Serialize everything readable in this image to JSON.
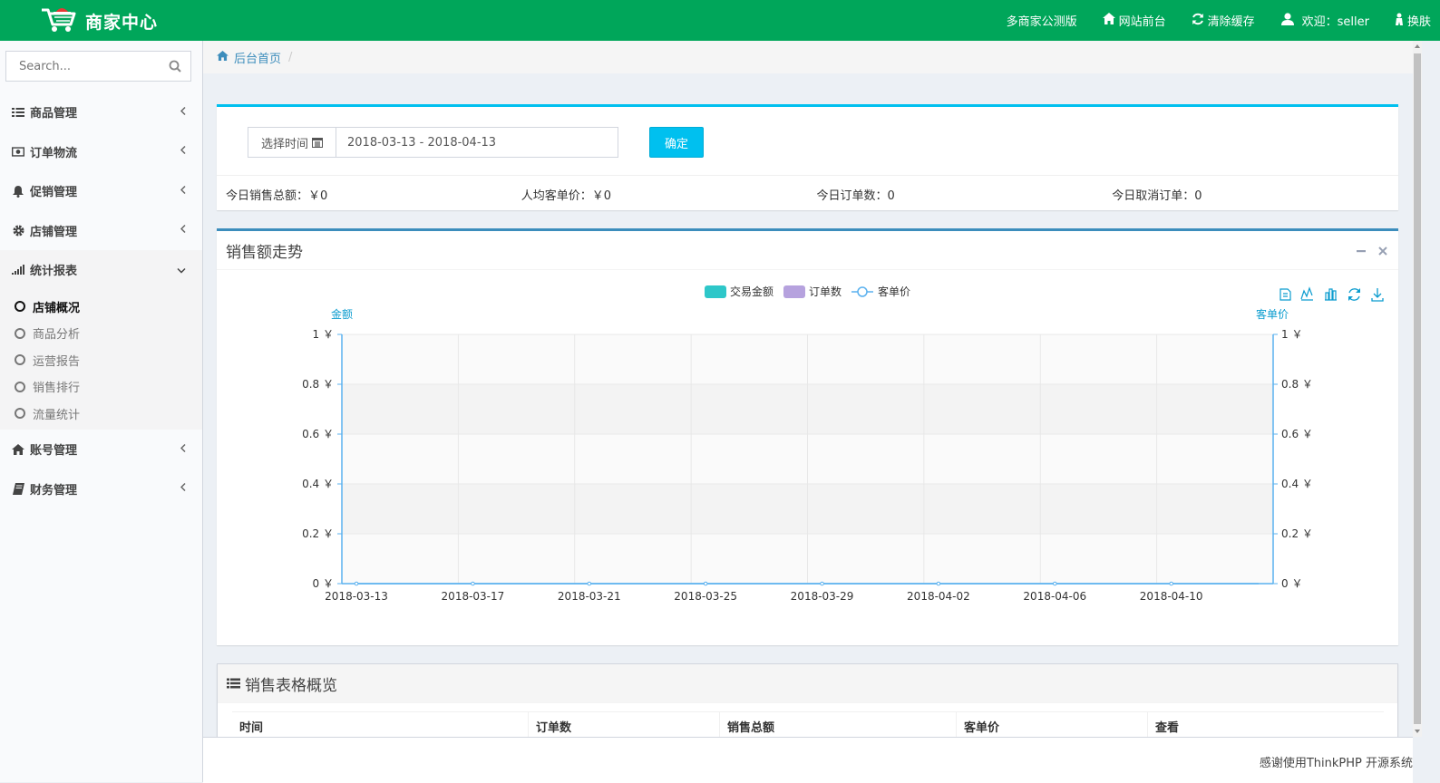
{
  "header": {
    "brand": "商家中心",
    "nav": [
      {
        "label": "多商家公测版",
        "icon": ""
      },
      {
        "label": "网站前台",
        "icon": "home-icon"
      },
      {
        "label": "清除缓存",
        "icon": "refresh-icon"
      },
      {
        "label": "欢迎：seller",
        "icon": "user-icon"
      },
      {
        "label": "换肤",
        "icon": "skin-icon"
      }
    ]
  },
  "sidebar": {
    "search": {
      "placeholder": "Search..."
    },
    "items": [
      {
        "label": "商品管理",
        "icon": "list-icon"
      },
      {
        "label": "订单物流",
        "icon": "money-icon"
      },
      {
        "label": "促销管理",
        "icon": "bell-icon"
      },
      {
        "label": "店铺管理",
        "icon": "gear-icon"
      },
      {
        "label": "统计报表",
        "icon": "signal-icon",
        "open": true
      },
      {
        "label": "账号管理",
        "icon": "home-icon"
      },
      {
        "label": "财务管理",
        "icon": "book-icon"
      }
    ],
    "sub_items": [
      {
        "label": "店铺概况",
        "active": true
      },
      {
        "label": "商品分析"
      },
      {
        "label": "运营报告"
      },
      {
        "label": "销售排行"
      },
      {
        "label": "流量统计"
      }
    ]
  },
  "breadcrumb": {
    "home": "后台首页",
    "sep": "/"
  },
  "filter": {
    "addon_label": "选择时间",
    "date_range": "2018-03-13 - 2018-04-13",
    "confirm_label": "确定"
  },
  "stats": [
    "今日销售总额：￥0",
    "人均客单价：￥0",
    "今日订单数：0",
    "今日取消订单：0"
  ],
  "chart_box": {
    "title": "销售额走势",
    "tools": {
      "minimize": "−",
      "close": "×"
    }
  },
  "chart_data": {
    "type": "bar",
    "legend": [
      {
        "name": "交易金额",
        "color": "#2ec7c9",
        "kind": "bar"
      },
      {
        "name": "订单数",
        "color": "#b6a2de",
        "kind": "bar"
      },
      {
        "name": "客单价",
        "color": "#5ab1ef",
        "kind": "line"
      }
    ],
    "ylabel_left": "金额",
    "ylabel_right": "客单价",
    "y_ticks_left": [
      "1 ￥",
      "0.8 ￥",
      "0.6 ￥",
      "0.4 ￥",
      "0.2 ￥",
      "0 ￥"
    ],
    "y_ticks_right": [
      "1 ￥",
      "0.8 ￥",
      "0.6 ￥",
      "0.4 ￥",
      "0.2 ￥",
      "0 ￥"
    ],
    "ylim": [
      0,
      1
    ],
    "x_tick_labels": [
      "2018-03-13",
      "2018-03-17",
      "2018-03-21",
      "2018-03-25",
      "2018-03-29",
      "2018-04-02",
      "2018-04-06",
      "2018-04-10"
    ],
    "start_date": "2018-03-13",
    "series": [
      {
        "name": "交易金额",
        "values": [
          0,
          0,
          0,
          0,
          0,
          0,
          0,
          0,
          0,
          0,
          0,
          0,
          0,
          0,
          0,
          0,
          0,
          0,
          0,
          0,
          0,
          0,
          0,
          0,
          0,
          0,
          0,
          0,
          0,
          0,
          0,
          0
        ]
      },
      {
        "name": "订单数",
        "values": [
          0,
          0,
          0,
          0,
          0,
          0,
          0,
          0,
          0,
          0,
          0,
          0,
          0,
          0,
          0,
          0,
          0,
          0,
          0,
          0,
          0,
          0,
          0,
          0,
          0,
          0,
          0,
          0,
          0,
          0,
          0,
          0
        ]
      },
      {
        "name": "客单价",
        "values": [
          0,
          0,
          0,
          0,
          0,
          0,
          0,
          0,
          0,
          0,
          0,
          0,
          0,
          0,
          0,
          0,
          0,
          0,
          0,
          0,
          0,
          0,
          0,
          0,
          0,
          0,
          0,
          0,
          0,
          0,
          0,
          0
        ]
      }
    ],
    "toolbox": [
      "data-view-icon",
      "line-chart-icon",
      "bar-chart-icon",
      "restore-icon",
      "save-image-icon"
    ],
    "colors": {
      "axis": "#5ab1ef",
      "band": "#f3f3f3",
      "grid": "#e8e8e8"
    }
  },
  "table_box": {
    "title": "销售表格概览",
    "columns": [
      "时间",
      "订单数",
      "销售总额",
      "客单价",
      "查看"
    ]
  },
  "footer": {
    "text": "感谢使用ThinkPHP 开源系统"
  }
}
